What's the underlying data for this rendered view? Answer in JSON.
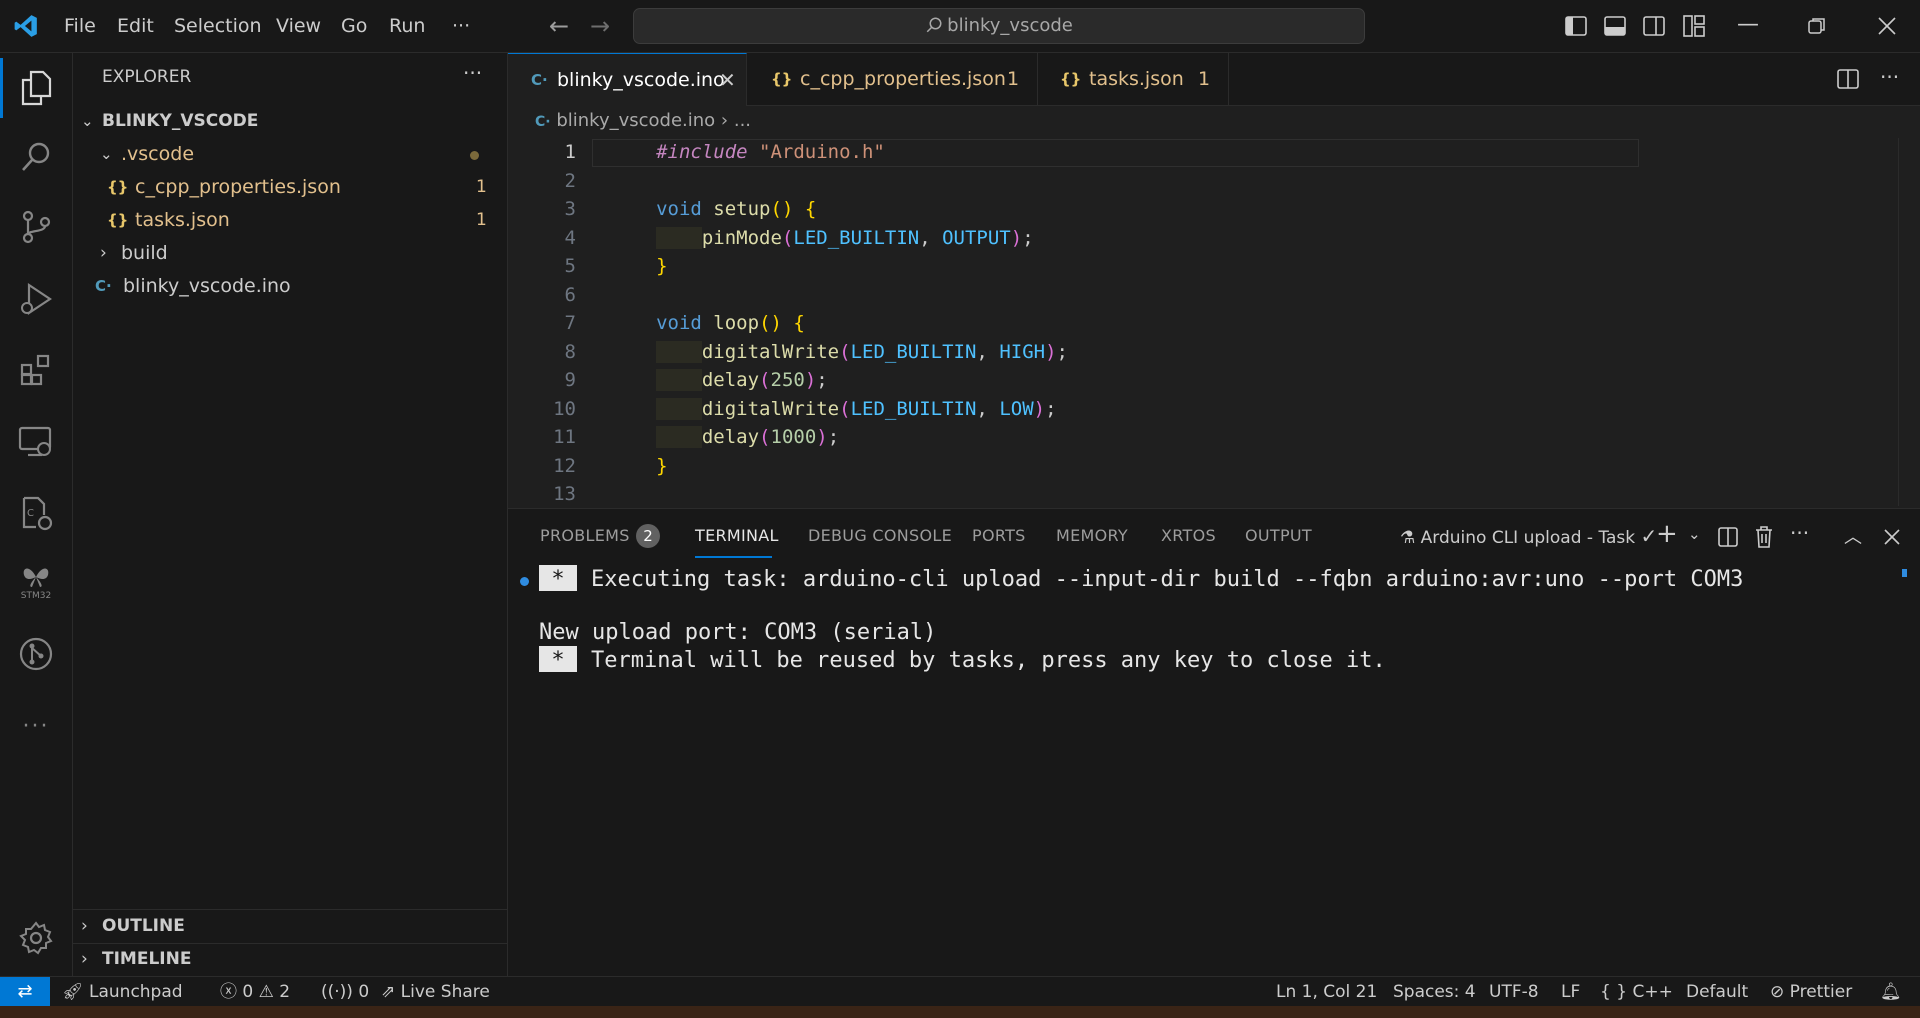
{
  "colors": {
    "accent": "#0078d4",
    "modified": "#e2c08d",
    "keyword": "#569cd6",
    "function": "#dcdcaa",
    "string": "#ce9178",
    "preproc": "#c586c0",
    "number": "#b5cea8",
    "constant": "#4fc1ff",
    "bracket_gold": "#ffd700",
    "bracket_pink": "#da70d6"
  },
  "titlebar": {
    "menus": [
      "File",
      "Edit",
      "Selection",
      "View",
      "Go",
      "Run",
      "···"
    ],
    "search": "blinky_vscode"
  },
  "activitybar": {
    "stm32_label": "STM32"
  },
  "sidebar": {
    "title": "EXPLORER",
    "project": "BLINKY_VSCODE",
    "tree": [
      {
        "name": ".vscode",
        "badge": ""
      },
      {
        "name": "c_cpp_properties.json",
        "badge": "1",
        "icon": "{}"
      },
      {
        "name": "tasks.json",
        "badge": "1",
        "icon": "{}"
      },
      {
        "name": "build",
        "badge": ""
      },
      {
        "name": "blinky_vscode.ino",
        "badge": ""
      }
    ],
    "outline": "OUTLINE",
    "timeline": "TIMELINE"
  },
  "tabs": [
    {
      "label": "blinky_vscode.ino",
      "badge": ""
    },
    {
      "label": "c_cpp_properties.json",
      "badge": "1"
    },
    {
      "label": "tasks.json",
      "badge": "1"
    }
  ],
  "breadcrumb": {
    "file": "blinky_vscode.ino",
    "rest": "..."
  },
  "code": {
    "line_numbers": [
      "1",
      "2",
      "3",
      "4",
      "5",
      "6",
      "7",
      "8",
      "9",
      "10",
      "11",
      "12",
      "13"
    ],
    "l1": {
      "directive": "#include",
      "string": "\"Arduino.h\""
    },
    "l3": {
      "kw": "void",
      "fn": "setup",
      "open": "()",
      "brace": "{"
    },
    "l4": {
      "fn": "pinMode",
      "arg1": "LED_BUILTIN",
      "arg2": "OUTPUT"
    },
    "l5": {
      "brace": "}"
    },
    "l7": {
      "kw": "void",
      "fn": "loop",
      "open": "()",
      "brace": "{"
    },
    "l8": {
      "fn": "digitalWrite",
      "arg1": "LED_BUILTIN",
      "arg2": "HIGH"
    },
    "l9": {
      "fn": "delay",
      "arg": "250"
    },
    "l10": {
      "fn": "digitalWrite",
      "arg1": "LED_BUILTIN",
      "arg2": "LOW"
    },
    "l11": {
      "fn": "delay",
      "arg": "1000"
    },
    "l12": {
      "brace": "}"
    }
  },
  "panel": {
    "tabs": [
      "PROBLEMS",
      "TERMINAL",
      "DEBUG CONSOLE",
      "PORTS",
      "MEMORY",
      "XRTOS",
      "OUTPUT"
    ],
    "problems_count": "2",
    "task_label": "Arduino CLI upload - Task",
    "terminal": {
      "star": "*",
      "line1": "Executing task: arduino-cli upload --input-dir build --fqbn arduino:avr:uno --port COM3",
      "line2": "New upload port: COM3 (serial)",
      "line3": "Terminal will be reused by tasks, press any key to close it."
    }
  },
  "statusbar": {
    "launchpad": "Launchpad",
    "errors": "0",
    "warnings": "2",
    "ports": "0",
    "live_share": "Live Share",
    "position": "Ln 1, Col 21",
    "spaces": "Spaces: 4",
    "encoding": "UTF-8",
    "eol": "LF",
    "language_icon": "{ }",
    "language": "C++",
    "profile": "Default",
    "prettier": "Prettier"
  }
}
